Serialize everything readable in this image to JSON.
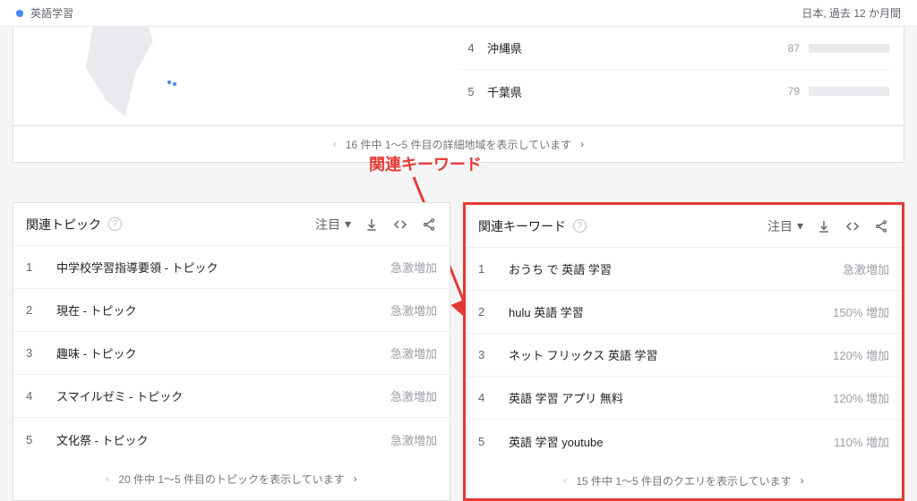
{
  "header": {
    "search_term": "英語学習",
    "scope": "日本, 過去 12 か月間"
  },
  "region_card": {
    "rows": [
      {
        "rank": 4,
        "name": "沖縄県",
        "score": 87
      },
      {
        "rank": 5,
        "name": "千葉県",
        "score": 79
      }
    ],
    "footer": "16 件中 1〜5 件目の詳細地域を表示しています"
  },
  "annotation": {
    "label": "関連キーワード"
  },
  "topics_panel": {
    "title": "関連トピック",
    "sort_label": "注目",
    "rows": [
      {
        "rank": 1,
        "label": "中学校学習指導要領 - トピック",
        "value": "急激増加"
      },
      {
        "rank": 2,
        "label": "現在 - トピック",
        "value": "急激増加"
      },
      {
        "rank": 3,
        "label": "趣味 - トピック",
        "value": "急激増加"
      },
      {
        "rank": 4,
        "label": "スマイルゼミ - トピック",
        "value": "急激増加"
      },
      {
        "rank": 5,
        "label": "文化祭 - トピック",
        "value": "急激増加"
      }
    ],
    "footer": "20 件中 1〜5 件目のトピックを表示しています"
  },
  "queries_panel": {
    "title": "関連キーワード",
    "sort_label": "注目",
    "rows": [
      {
        "rank": 1,
        "label": "おうち で 英語 学習",
        "value": "急激増加"
      },
      {
        "rank": 2,
        "label": "hulu 英語 学習",
        "value": "150% 増加"
      },
      {
        "rank": 3,
        "label": "ネット フリックス 英語 学習",
        "value": "120% 増加"
      },
      {
        "rank": 4,
        "label": "英語 学習 アプリ 無料",
        "value": "120% 増加"
      },
      {
        "rank": 5,
        "label": "英語 学習 youtube",
        "value": "110% 増加"
      }
    ],
    "footer": "15 件中 1〜5 件目のクエリを表示しています"
  },
  "icons": {
    "download": "download-icon",
    "embed": "embed-icon",
    "share": "share-icon",
    "chev_down": "chevron-down-icon",
    "chev_left": "chevron-left-icon",
    "chev_right": "chevron-right-icon",
    "help": "help-icon"
  }
}
